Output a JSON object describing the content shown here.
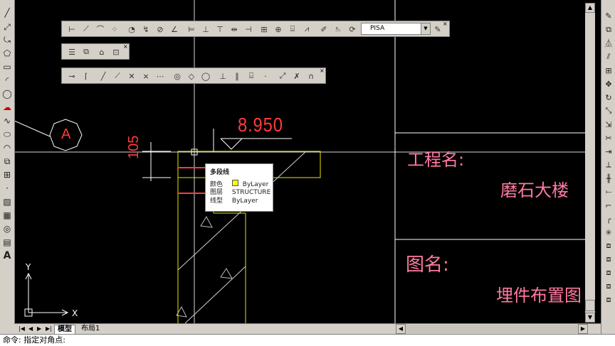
{
  "colors": {
    "background": "#000000",
    "toolbar": "#d4d0c8",
    "crosshair": "#e0e0e0",
    "dimension": "#ff3b3b",
    "title_text": "#ff7aa0",
    "frame": "#ffffff",
    "geometry": "#e6e600"
  },
  "left_toolbar": {
    "icons": [
      "line-icon",
      "construction-line-icon",
      "polyline-icon",
      "polygon-icon",
      "rectangle-icon",
      "arc-icon",
      "circle-icon",
      "revision-cloud-icon",
      "spline-icon",
      "ellipse-icon",
      "ellipse-arc-icon",
      "insert-block-icon",
      "make-block-icon",
      "point-icon",
      "hatch-icon",
      "gradient-icon",
      "region-icon",
      "table-icon",
      "multiline-text-icon"
    ],
    "text_tool_glyph": "A"
  },
  "right_toolbar": {
    "icons": [
      "erase-icon",
      "copy-icon",
      "mirror-icon",
      "offset-icon",
      "array-icon",
      "move-icon",
      "rotate-icon",
      "scale-icon",
      "stretch-icon",
      "trim-icon",
      "extend-icon",
      "break-at-point-icon",
      "break-icon",
      "join-icon",
      "chamfer-icon",
      "fillet-icon",
      "explode-icon"
    ]
  },
  "toolbar_dimension": {
    "icons": [
      "linear-dim-icon",
      "aligned-dim-icon",
      "arc-length-icon",
      "ordinate-icon",
      "radius-icon",
      "jogged-icon",
      "diameter-icon",
      "angular-icon",
      "quick-dim-icon",
      "baseline-icon",
      "continue-icon",
      "dim-space-icon",
      "dim-break-icon",
      "tolerance-icon",
      "center-mark-icon",
      "inspection-icon",
      "jogged-linear-icon",
      "dim-edit-icon",
      "dim-text-edit-icon",
      "dim-update-icon"
    ],
    "style_value": "PISA"
  },
  "toolbar_small": {
    "icons": [
      "layer-icon",
      "layer-states-icon",
      "match-properties-icon",
      "zoom-window-icon"
    ]
  },
  "toolbar_object_snap": {
    "icons": [
      "temp-track-icon",
      "snap-from-icon",
      "endpoint-icon",
      "midpoint-icon",
      "intersection-icon",
      "apparent-intersection-icon",
      "extension-icon",
      "center-icon",
      "quadrant-icon",
      "tangent-icon",
      "perpendicular-icon",
      "parallel-icon",
      "insert-snap-icon",
      "node-icon",
      "nearest-icon",
      "snap-none-icon",
      "osnap-settings-icon"
    ]
  },
  "drawing": {
    "dimension_value": "8.950",
    "dimension_vertical": "105",
    "axis_marker": "A",
    "title_block": {
      "project_label": "工程名:",
      "project_value": "磨石大楼",
      "drawing_label": "图名:",
      "drawing_value": "埋件布置图"
    },
    "ucs": {
      "x": "X",
      "y": "Y"
    }
  },
  "tooltip": {
    "title": "多段线",
    "rows": [
      {
        "label": "颜色",
        "value": "ByLayer"
      },
      {
        "label": "图层",
        "value": "STRUCTURE"
      },
      {
        "label": "线型",
        "value": "ByLayer"
      }
    ]
  },
  "tabs": {
    "model": "模型",
    "layout1": "布局1"
  },
  "command_line": "命令: 指定对角点:"
}
